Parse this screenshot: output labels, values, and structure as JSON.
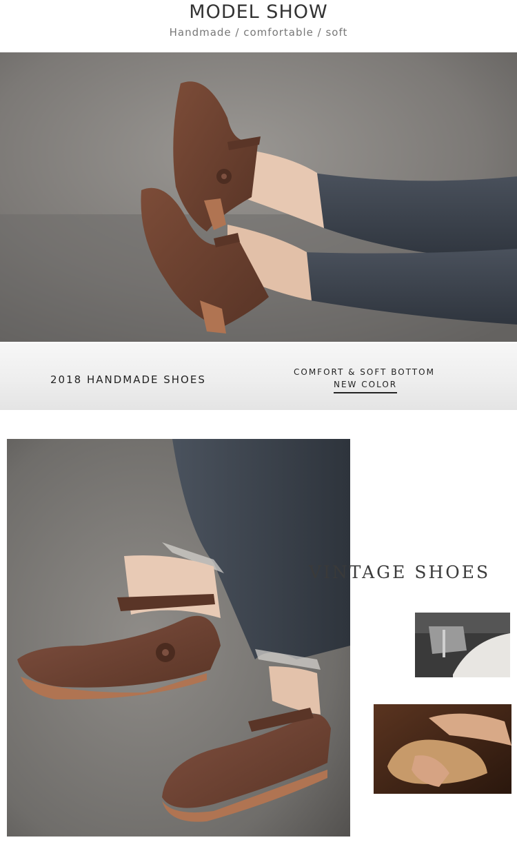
{
  "header": {
    "title": "MODEL SHOW",
    "subtitle": "Handmade / comfortable / soft"
  },
  "banner": {
    "left_text": "2018 HANDMADE SHOES",
    "right_top": "COMFORT & SOFT BOTTOM",
    "right_bottom": "NEW COLOR"
  },
  "feature": {
    "headline": "VINTAGE SHOES"
  },
  "colors": {
    "leather": "#6b4030",
    "sole": "#b07452",
    "denim": "#3e4550",
    "backdrop": "#7e7b78"
  },
  "images": {
    "hero": "model-wearing-brown-leather-mary-jane-shoes",
    "closeup": "brown-leather-flower-flats-with-jeans",
    "thumb_machine": "sewing-machine-stitching-leather",
    "thumb_craft": "hands-crafting-leather-shoe"
  }
}
